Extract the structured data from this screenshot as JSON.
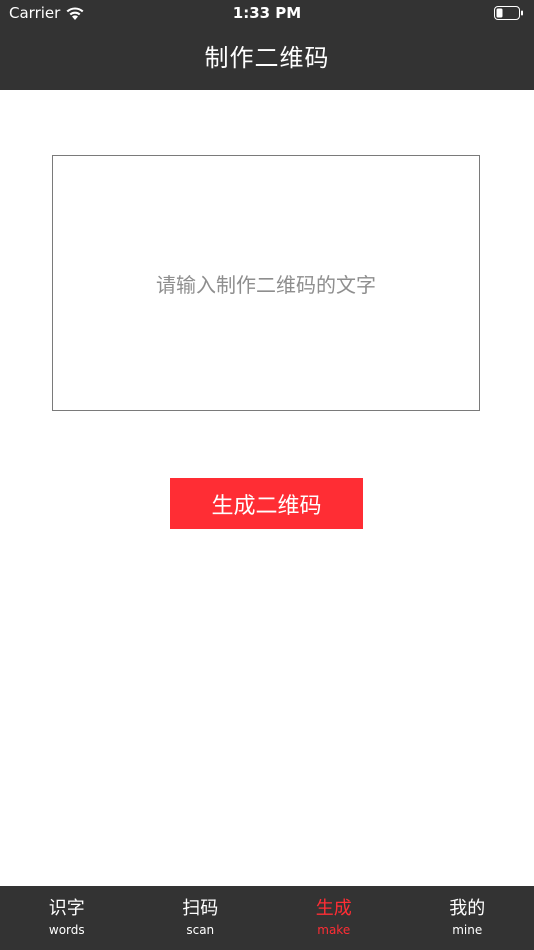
{
  "status_bar": {
    "carrier": "Carrier",
    "time": "1:33 PM",
    "wifi_icon": "wifi-icon",
    "battery_icon": "battery-icon"
  },
  "nav": {
    "title": "制作二维码"
  },
  "input": {
    "placeholder": "请输入制作二维码的文字",
    "value": ""
  },
  "generate_button": {
    "label": "生成二维码",
    "color": "#ff2d34"
  },
  "tabs": [
    {
      "label": "识字",
      "sub": "words",
      "active": false
    },
    {
      "label": "扫码",
      "sub": "scan",
      "active": false
    },
    {
      "label": "生成",
      "sub": "make",
      "active": true
    },
    {
      "label": "我的",
      "sub": "mine",
      "active": false
    }
  ],
  "colors": {
    "bar_background": "#333333",
    "accent": "#ff2d34",
    "placeholder": "#8e8e8e"
  }
}
